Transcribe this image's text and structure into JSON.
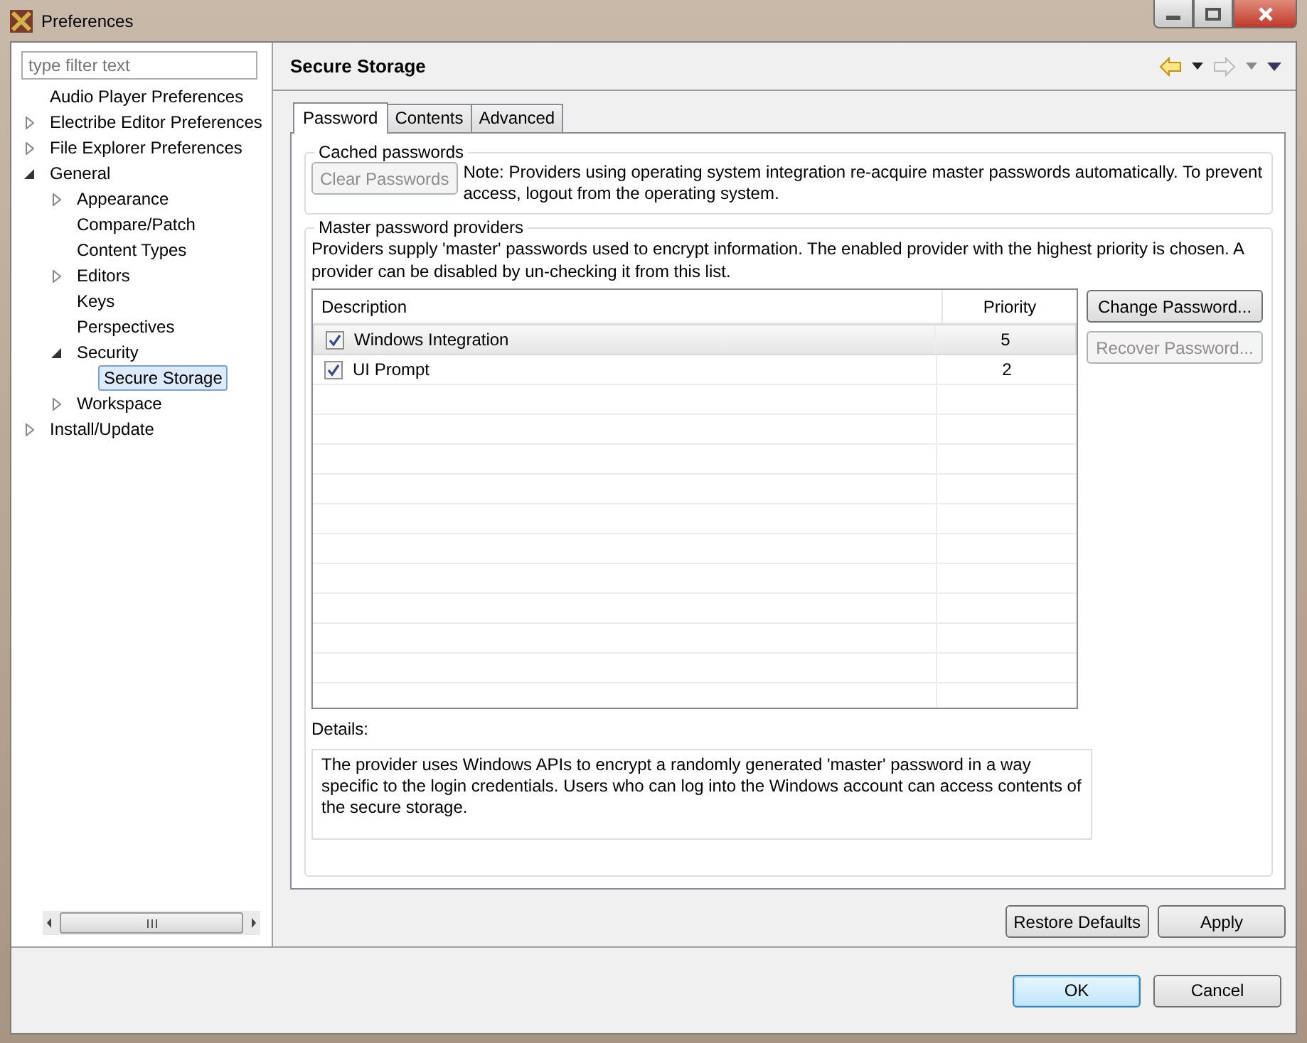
{
  "window": {
    "title": "Preferences"
  },
  "filter": {
    "placeholder": "type filter text"
  },
  "tree": [
    {
      "label": "Audio Player Preferences",
      "expandable": false,
      "selected": false
    },
    {
      "label": "Electribe Editor Preferences",
      "expandable": true,
      "expanded": false,
      "selected": false
    },
    {
      "label": "File Explorer Preferences",
      "expandable": true,
      "expanded": false,
      "selected": false
    },
    {
      "label": "General",
      "expandable": true,
      "expanded": true,
      "selected": false,
      "children": [
        {
          "label": "Appearance",
          "expandable": true,
          "expanded": false,
          "selected": false
        },
        {
          "label": "Compare/Patch",
          "expandable": false,
          "selected": false
        },
        {
          "label": "Content Types",
          "expandable": false,
          "selected": false
        },
        {
          "label": "Editors",
          "expandable": true,
          "expanded": false,
          "selected": false
        },
        {
          "label": "Keys",
          "expandable": false,
          "selected": false
        },
        {
          "label": "Perspectives",
          "expandable": false,
          "selected": false
        },
        {
          "label": "Security",
          "expandable": true,
          "expanded": true,
          "selected": false,
          "children": [
            {
              "label": "Secure Storage",
              "expandable": false,
              "selected": true
            }
          ]
        },
        {
          "label": "Workspace",
          "expandable": true,
          "expanded": false,
          "selected": false
        }
      ]
    },
    {
      "label": "Install/Update",
      "expandable": true,
      "expanded": false,
      "selected": false
    }
  ],
  "page": {
    "title": "Secure Storage"
  },
  "tabs": [
    {
      "label": "Password",
      "selected": true
    },
    {
      "label": "Contents",
      "selected": false
    },
    {
      "label": "Advanced",
      "selected": false
    }
  ],
  "cached": {
    "title": "Cached passwords",
    "button": {
      "label": "Clear Passwords",
      "disabled": true
    },
    "note": "Note: Providers using operating system integration re-acquire master passwords automatically. To prevent access, logout from the operating system."
  },
  "providers": {
    "title": "Master password providers",
    "description": "Providers supply 'master' passwords used to encrypt information. The enabled provider with the highest priority is chosen. A provider can be disabled by un-checking it from this list.",
    "columns": [
      "Description",
      "Priority"
    ],
    "rows": [
      {
        "checked": true,
        "description": "Windows Integration",
        "priority": "5",
        "selected": true
      },
      {
        "checked": true,
        "description": "UI Prompt",
        "priority": "2",
        "selected": false
      }
    ],
    "buttons": [
      {
        "label": "Change Password...",
        "disabled": false
      },
      {
        "label": "Recover Password...",
        "disabled": true
      }
    ],
    "details_label": "Details:",
    "details": "The provider uses Windows APIs to encrypt a randomly generated 'master' password in a way specific to the login credentials. Users who can log into the Windows account can access contents of the secure storage."
  },
  "page_buttons": [
    "Restore Defaults",
    "Apply"
  ],
  "dialog_buttons": [
    {
      "label": "OK",
      "default": true
    },
    {
      "label": "Cancel",
      "default": false
    }
  ]
}
